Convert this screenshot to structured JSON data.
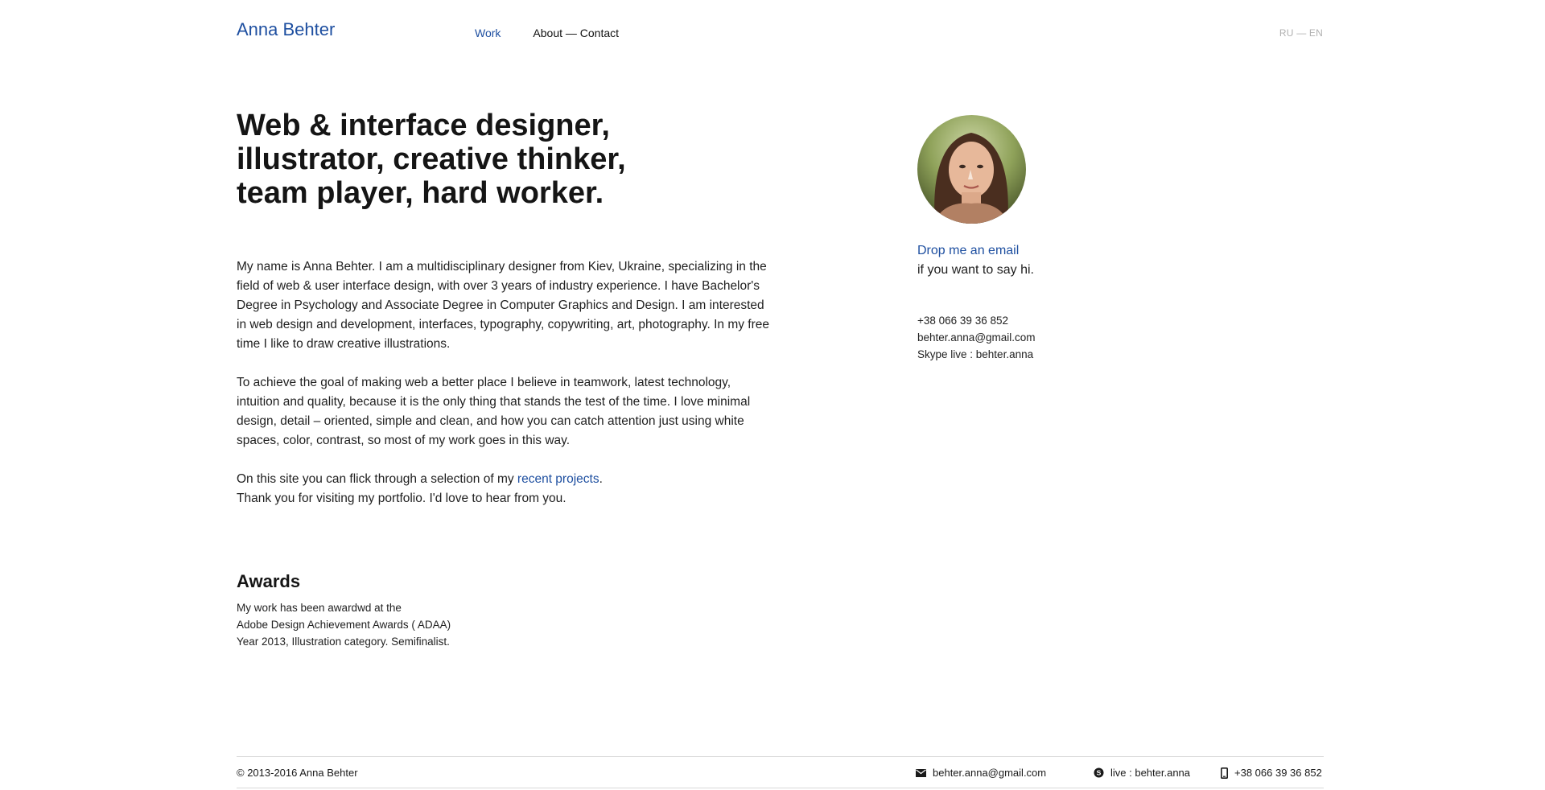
{
  "header": {
    "brand": "Anna Behter",
    "nav": [
      {
        "label": "Work",
        "active": true
      },
      {
        "label": "About — Contact",
        "active": false
      }
    ],
    "lang": "RU — EN"
  },
  "hero": {
    "headline_lines": [
      "Web & interface designer,",
      "illustrator, creative thinker,",
      "team player, hard worker."
    ]
  },
  "bio": {
    "p1": "My name is Anna Behter. I am a multidisciplinary designer from Kiev, Ukraine, specializing in the field of web & user interface design, with over 3 years of industry experience. I have Bachelor's Degree in Psychology and  Associate Degree in Computer Graphics and Design. I am interested in web design and development, interfaces, typography, copywriting, art, photography. In my free time I like to draw creative illustrations.",
    "p2": "To achieve the goal of making web a better place I believe in teamwork, latest technology, intuition and quality, because it is the only thing that stands the test of the time. I love minimal design, detail – oriented, simple and clean, and how you can catch attention just using white spaces, color, contrast, so most of my work goes in this way.",
    "p3_before": "On this site you can flick through a selection of my ",
    "p3_link": "recent projects",
    "p3_after": ".",
    "p4": "Thank you for visiting my portfolio. I'd love to hear from you."
  },
  "awards": {
    "title": "Awards",
    "lines": [
      "My work has been awardwd at the",
      "Adobe Design Achievement Awards ( ADAA)",
      "Year 2013, Illustration category. Semifinalist."
    ]
  },
  "contact": {
    "cta_link": "Drop me an email",
    "cta_text": "if you want to say hi.",
    "lines": [
      "+38 066 39 36 852",
      "behter.anna@gmail.com",
      "Skype live : behter.anna"
    ]
  },
  "footer": {
    "copyright": "© 2013-2016 Anna Behter",
    "email": "behter.anna@gmail.com",
    "skype": "live : behter.anna",
    "phone": "+38 066 39 36 852"
  },
  "colors": {
    "accent": "#1e4fa0",
    "text": "#1a1a1a",
    "muted": "#b0b0b0"
  },
  "icons": [
    "envelope-icon",
    "skype-icon",
    "phone-icon"
  ]
}
